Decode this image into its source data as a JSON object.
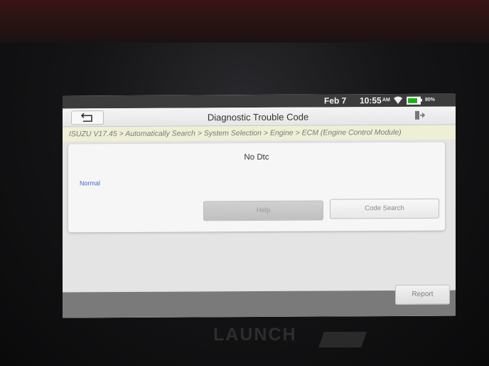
{
  "status_bar": {
    "date": "Feb 7",
    "time": "10:55",
    "ampm": "AM",
    "battery_pct": "80%",
    "battery_color": "#17b319"
  },
  "header": {
    "title": "Diagnostic Trouble Code",
    "back_icon": "back-arrow-icon",
    "exit_icon": "exit-icon"
  },
  "breadcrumb": "ISUZU V17.45 > Automatically Search > System Selection > Engine > ECM (Engine Control Module)",
  "result": {
    "message": "No Dtc",
    "status": "Normal",
    "status_color": "#3a6ac4"
  },
  "buttons": {
    "help": "Help",
    "code_search": "Code Search",
    "report": "Report"
  },
  "device": {
    "brand": "LAUNCH"
  }
}
